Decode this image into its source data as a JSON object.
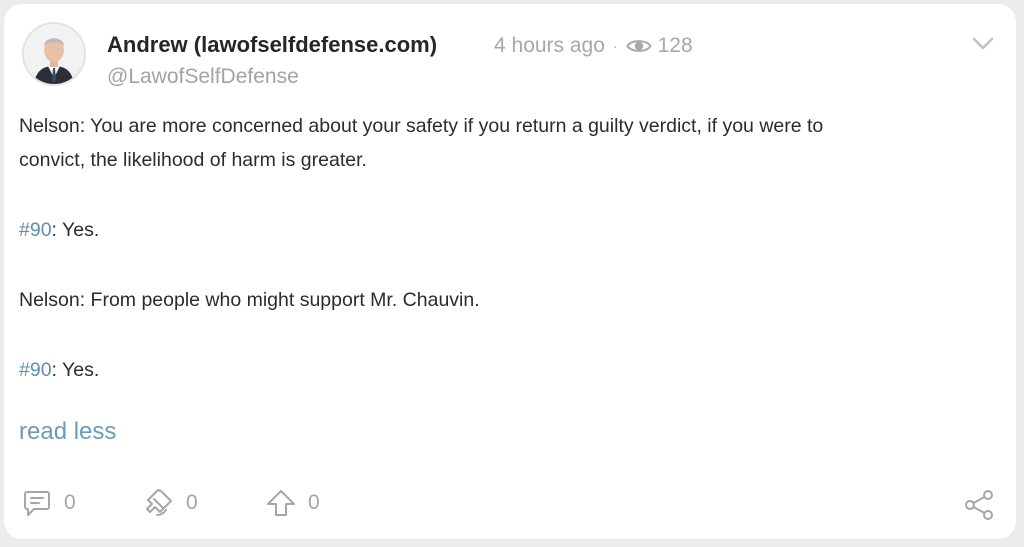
{
  "post": {
    "author": {
      "name": "Andrew (lawofselfdefense.com)",
      "handle": "@LawofSelfDefense"
    },
    "time": "4 hours ago",
    "separator": "·",
    "views": "128",
    "paragraphs": [
      {
        "lines": [
          "Nelson: You are more concerned about your safety if you return a guilty verdict, if you were to",
          "convict, the likelihood of harm is greater."
        ]
      },
      {
        "hashtag": "#90",
        "rest": ": Yes."
      },
      {
        "lines": [
          "Nelson: From people who might support Mr. Chauvin."
        ]
      },
      {
        "hashtag": "#90",
        "rest": ": Yes."
      }
    ],
    "read_less": "read less",
    "actions": {
      "comments": "0",
      "reposts": "0",
      "upvotes": "0"
    }
  },
  "icons": {
    "expand": "chevron-down-icon",
    "views": "eye-icon",
    "comment": "comment-icon",
    "repost": "repost-icon",
    "upvote": "upvote-arrow-icon",
    "share": "share-icon"
  },
  "colors": {
    "link": "#6a9bbd",
    "hashtag": "#5e8fb1",
    "muted": "#a8a8a8",
    "text": "#2c2c2c"
  }
}
